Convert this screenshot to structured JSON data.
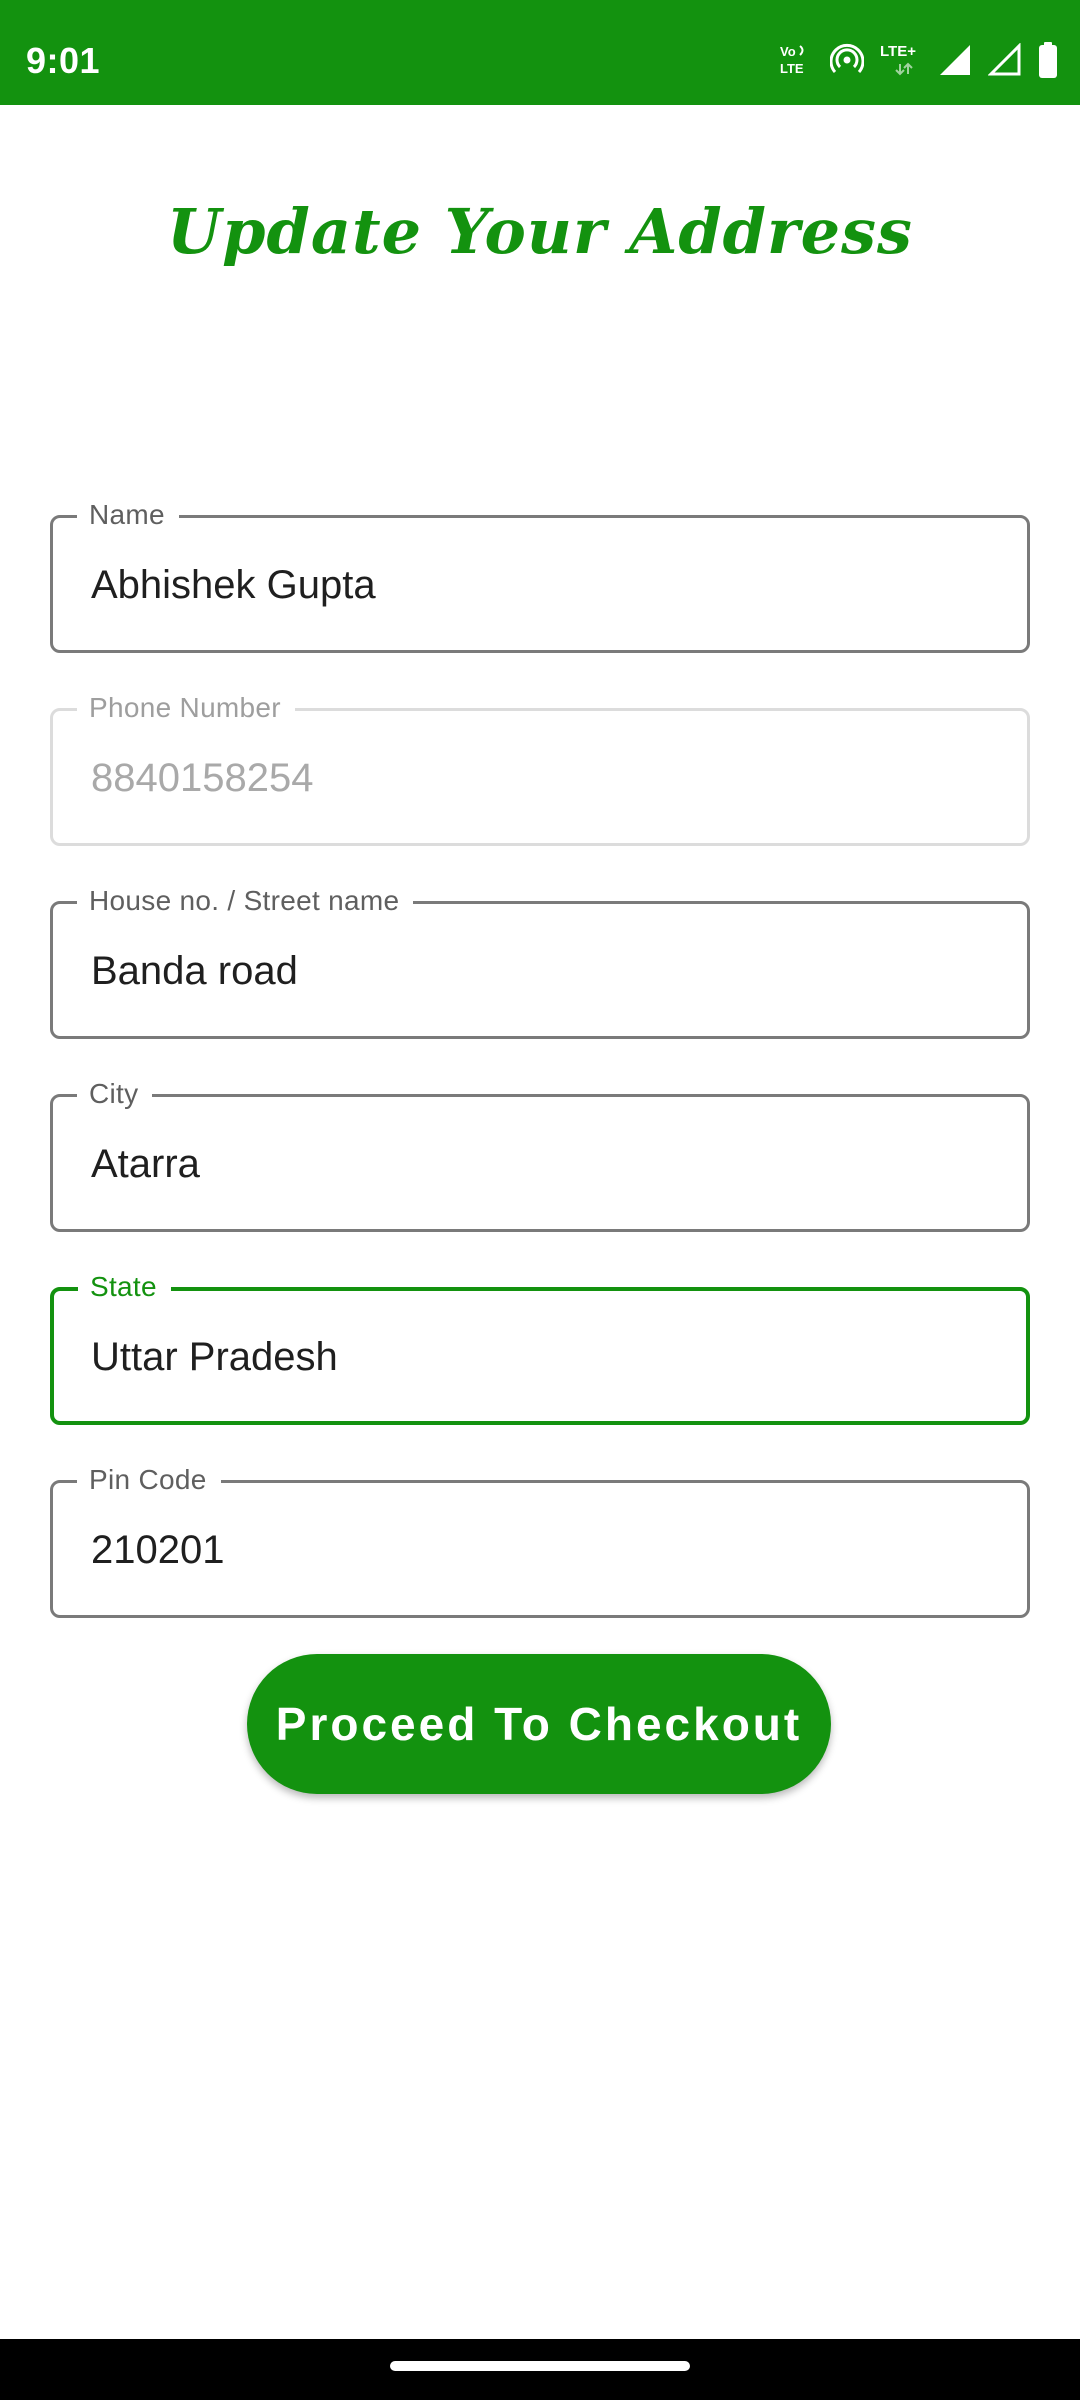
{
  "status_bar": {
    "time": "9:01",
    "volte_label": "Vo)\nLTE",
    "lte_label": "LTE+",
    "icons": [
      "volte-icon",
      "hotspot-icon",
      "lte-plus-icon",
      "signal-full-icon",
      "signal-empty-icon",
      "battery-icon"
    ],
    "background": "#13920f"
  },
  "title": "Update Your Address",
  "form": {
    "name": {
      "label": "Name",
      "value": "Abhishek Gupta"
    },
    "phone": {
      "label": "Phone Number",
      "value": "8840158254",
      "disabled": true
    },
    "street": {
      "label": "House no. / Street name",
      "value": "Banda road"
    },
    "city": {
      "label": "City",
      "value": "Atarra"
    },
    "state": {
      "label": "State",
      "value": "Uttar Pradesh",
      "focused": true
    },
    "pin": {
      "label": "Pin Code",
      "value": "210201"
    }
  },
  "checkout_button": {
    "label": "Proceed To Checkout"
  },
  "colors": {
    "accent": "#13920f",
    "border": "#7a7a7a",
    "disabled_border": "#dcdcdc",
    "text": "#1f1f1f"
  }
}
